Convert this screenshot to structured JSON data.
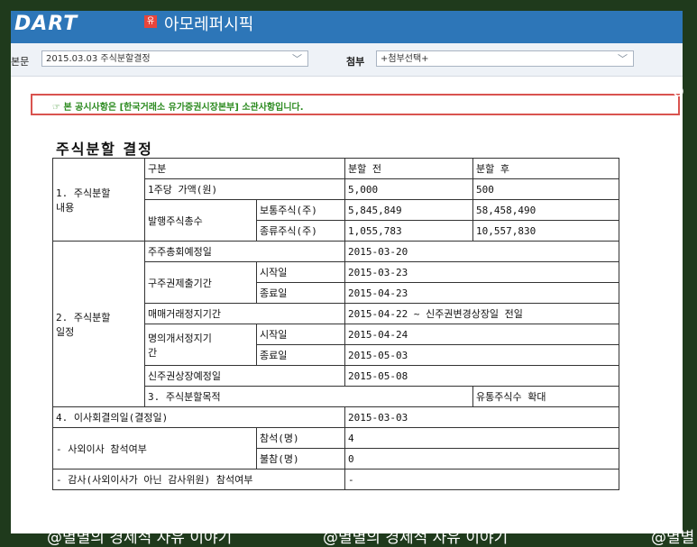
{
  "header": {
    "logo": "DART",
    "company_icon": "유",
    "company_name": "아모레퍼시픽"
  },
  "toolbar": {
    "body_label": "본문",
    "body_select_value": "2015.03.03  주식분할결정",
    "attach_label": "첨부",
    "attach_select_value": "+첨부선택+"
  },
  "notice": "☞ 본 공시사항은 [한국거래소 유가증권시장본부] 소관사항입니다.",
  "edge_char": "O",
  "document_title": "주식분할 결정",
  "table": {
    "h_gubun": "구분",
    "h_before": "분할 전",
    "h_after": "분할 후",
    "s1_label": "1. 주식분할\n내용",
    "par_value_label": "1주당 가액(원)",
    "par_value_before": "5,000",
    "par_value_after": "500",
    "issued_label": "발행주식총수",
    "common_label": "보통주식(주)",
    "common_before": "5,845,849",
    "common_after": "58,458,490",
    "preferred_label": "종류주식(주)",
    "preferred_before": "1,055,783",
    "preferred_after": "10,557,830",
    "s2_label": "2. 주식분할\n일정",
    "agm_label": "주주총회예정일",
    "agm_value": "2015-03-20",
    "old_cert_label": "구주권제출기간",
    "start_label": "시작일",
    "end_label": "종료일",
    "old_cert_start": "2015-03-23",
    "old_cert_end": "2015-04-23",
    "suspension_label": "매매거래정지기간",
    "suspension_value": "2015-04-22 ~ 신주권변경상장일 전일",
    "transfer_label": "명의개서정지기\n간",
    "transfer_start": "2015-04-24",
    "transfer_end": "2015-05-03",
    "listing_label": "신주권상장예정일",
    "listing_value": "2015-05-08",
    "s3_label": "3. 주식분할목적",
    "s3_value": "유통주식수 확대",
    "s4_label": "4. 이사회결의일(결정일)",
    "s4_value": "2015-03-03",
    "outside_dir_label": "- 사외이사 참석여부",
    "attend_label": "참석(명)",
    "attend_value": "4",
    "absent_label": "불참(명)",
    "absent_value": "0",
    "auditor_label": "- 감사(사외이사가 아닌 감사위원) 참석여부",
    "auditor_value": "-"
  },
  "watermarks": [
    "@별별의 경제적 자유 이야기",
    "@별별의 경제적 자유 이야기",
    "@별별"
  ]
}
